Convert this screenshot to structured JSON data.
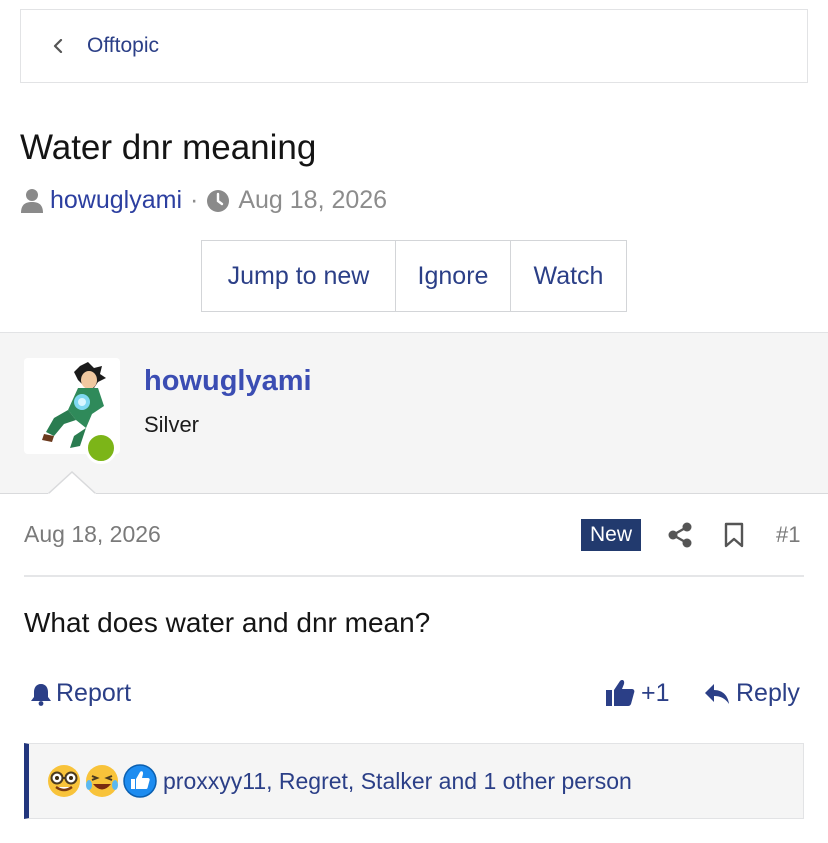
{
  "breadcrumb": {
    "label": "Offtopic"
  },
  "thread": {
    "title": "Water dnr meaning",
    "author": "howuglyami",
    "separator": "·",
    "date": "Aug 18, 2026"
  },
  "actions": {
    "jump_to_new": "Jump to new",
    "ignore": "Ignore",
    "watch": "Watch"
  },
  "user_panel": {
    "username": "howuglyami",
    "rank": "Silver",
    "online": true
  },
  "post": {
    "date": "Aug 18, 2026",
    "badge": "New",
    "number": "#1",
    "body": "What does water and dnr mean?",
    "report_label": "Report",
    "like_count": "+1",
    "reply_label": "Reply"
  },
  "reactions": {
    "icons": [
      "nerd-face-icon",
      "laughing-crying-icon",
      "like-icon"
    ],
    "text": "proxxyy11, Regret, Stalker and 1 other person"
  },
  "colors": {
    "link": "#2b3f87",
    "username": "#3b4db3",
    "badge_bg": "#223a6e",
    "online": "#7cb518",
    "panel_bg": "#f5f5f5",
    "muted": "#7a7a7a"
  }
}
